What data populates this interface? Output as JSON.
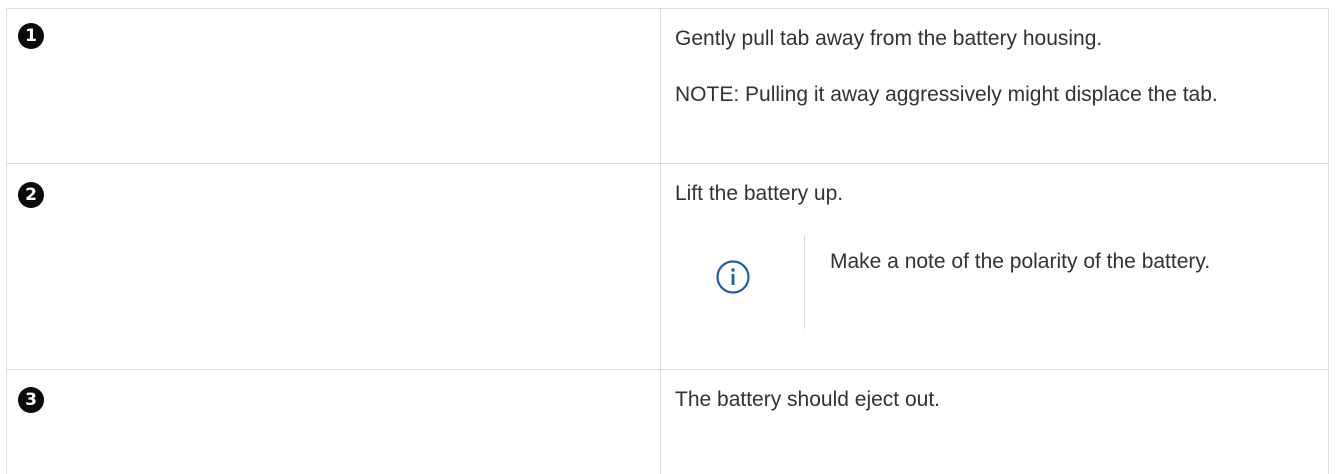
{
  "steps": [
    {
      "callout": "1",
      "paragraphs": [
        "Gently pull tab away from the battery housing.",
        "NOTE: Pulling it away aggressively might displace the tab."
      ]
    },
    {
      "callout": "2",
      "paragraphs": [
        "Lift the battery up."
      ],
      "note": {
        "icon": "info-icon",
        "text": "Make a note of the polarity of the battery."
      }
    },
    {
      "callout": "3",
      "paragraphs": [
        "The battery should eject out."
      ]
    }
  ],
  "colors": {
    "text": "#333333",
    "border": "#dcdcdc",
    "callout_bg": "#0b0b0b",
    "info_icon": "#1f5fa8"
  }
}
